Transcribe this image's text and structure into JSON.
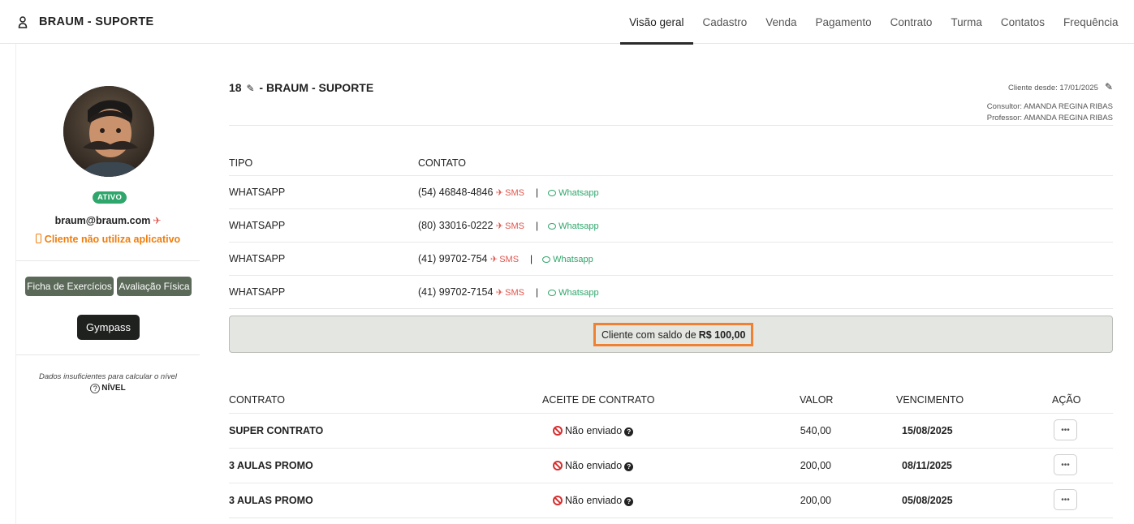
{
  "header": {
    "title": "BRAUM - SUPORTE",
    "tabs": [
      {
        "label": "Visão geral",
        "active": true
      },
      {
        "label": "Cadastro"
      },
      {
        "label": "Venda"
      },
      {
        "label": "Pagamento"
      },
      {
        "label": "Contrato"
      },
      {
        "label": "Turma"
      },
      {
        "label": "Contatos"
      },
      {
        "label": "Frequência"
      }
    ]
  },
  "sidebar": {
    "status": "ATIVO",
    "email": "braum@braum.com",
    "app_status": "Cliente não utiliza aplicativo",
    "buttons": {
      "ficha": "Ficha de Exercícios",
      "avaliacao": "Avaliação Física",
      "gympass": "Gympass"
    },
    "level_text": "Dados insuficientes para calcular o nível",
    "level_label": "NÍVEL"
  },
  "client": {
    "id": "18",
    "name": "- BRAUM - SUPORTE",
    "since": "Cliente desde: 17/01/2025",
    "consultor": "Consultor: AMANDA REGINA RIBAS",
    "professor": "Professor: AMANDA REGINA RIBAS"
  },
  "contacts": {
    "headers": {
      "tipo": "TIPO",
      "contato": "CONTATO"
    },
    "sms_label": "SMS",
    "whatsapp_label": "Whatsapp",
    "rows": [
      {
        "tipo": "WHATSAPP",
        "phone": "(54) 46848-4846"
      },
      {
        "tipo": "WHATSAPP",
        "phone": "(80) 33016-0222"
      },
      {
        "tipo": "WHATSAPP",
        "phone": "(41) 99702-754"
      },
      {
        "tipo": "WHATSAPP",
        "phone": "(41) 99702-7154"
      }
    ]
  },
  "balance": {
    "text": "Cliente com saldo de",
    "amount": "R$ 100,00"
  },
  "contracts": {
    "headers": {
      "contrato": "CONTRATO",
      "aceite": "ACEITE DE CONTRATO",
      "valor": "VALOR",
      "vencimento": "VENCIMENTO",
      "acao": "AÇÃO"
    },
    "rows": [
      {
        "name": "SUPER CONTRATO",
        "aceite": "Não enviado",
        "valor": "540,00",
        "vencimento": "15/08/2025"
      },
      {
        "name": "3 AULAS PROMO",
        "aceite": "Não enviado",
        "valor": "200,00",
        "vencimento": "08/11/2025"
      },
      {
        "name": "3 AULAS PROMO",
        "aceite": "Não enviado",
        "valor": "200,00",
        "vencimento": "05/08/2025"
      }
    ]
  },
  "colors": {
    "accent_orange": "#ef7d0d",
    "highlight_border": "#f08133",
    "sms_red": "#e0574f",
    "whatsapp_green": "#2fa66b",
    "button_green": "#5b6a58"
  }
}
